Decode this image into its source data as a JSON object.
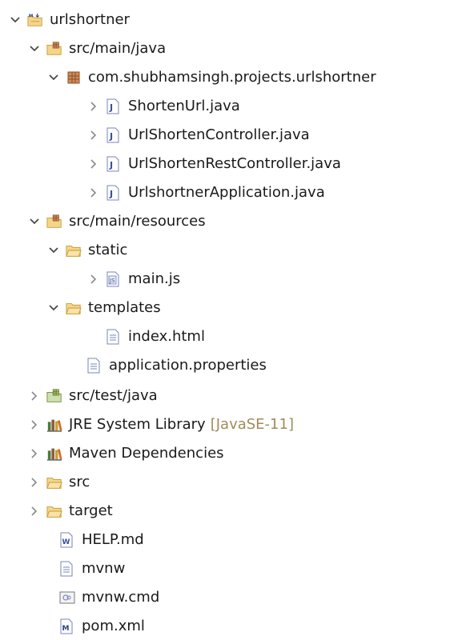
{
  "tree": {
    "project": {
      "label": "urlshortner",
      "icon": "maven-project-icon",
      "expanded": true
    },
    "src_main_java": {
      "label": "src/main/java",
      "icon": "source-folder-icon",
      "expanded": true
    },
    "package": {
      "label": "com.shubhamsingh.projects.urlshortner",
      "icon": "package-icon",
      "expanded": true
    },
    "files_java": [
      {
        "label": "ShortenUrl.java",
        "icon": "java-file-icon"
      },
      {
        "label": "UrlShortenController.java",
        "icon": "java-file-icon"
      },
      {
        "label": "UrlShortenRestController.java",
        "icon": "java-file-icon"
      },
      {
        "label": "UrlshortnerApplication.java",
        "icon": "java-file-icon"
      }
    ],
    "src_main_resources": {
      "label": "src/main/resources",
      "icon": "source-folder-icon",
      "expanded": true
    },
    "static_folder": {
      "label": "static",
      "icon": "folder-icon",
      "expanded": true
    },
    "main_js": {
      "label": "main.js",
      "icon": "js-file-icon"
    },
    "templates_folder": {
      "label": "templates",
      "icon": "folder-icon",
      "expanded": true
    },
    "index_html": {
      "label": "index.html",
      "icon": "text-file-icon"
    },
    "app_properties": {
      "label": "application.properties",
      "icon": "text-file-icon"
    },
    "src_test_java": {
      "label": "src/test/java",
      "icon": "source-folder-icon",
      "expanded": false
    },
    "jre_lib": {
      "label": "JRE System Library",
      "decoration": "[JavaSE-11]",
      "icon": "library-icon",
      "expanded": false
    },
    "maven_deps": {
      "label": "Maven Dependencies",
      "icon": "library-icon",
      "expanded": false
    },
    "src_folder": {
      "label": "src",
      "icon": "folder-icon",
      "expanded": false
    },
    "target_folder": {
      "label": "target",
      "icon": "folder-icon",
      "expanded": false
    },
    "help_md": {
      "label": "HELP.md",
      "icon": "markdown-file-icon"
    },
    "mvnw": {
      "label": "mvnw",
      "icon": "text-file-icon"
    },
    "mvnw_cmd": {
      "label": "mvnw.cmd",
      "icon": "cmd-file-icon"
    },
    "pom_xml": {
      "label": "pom.xml",
      "icon": "pom-file-icon"
    }
  },
  "colors": {
    "toggle": "#4a4a4a",
    "folder_fill": "#f4d58a",
    "folder_stroke": "#c89b35",
    "package_fill": "#d08a58",
    "java_file": "#6b7ab8",
    "library_books": "#8b5e3c",
    "decoration": "#a28a5b"
  }
}
